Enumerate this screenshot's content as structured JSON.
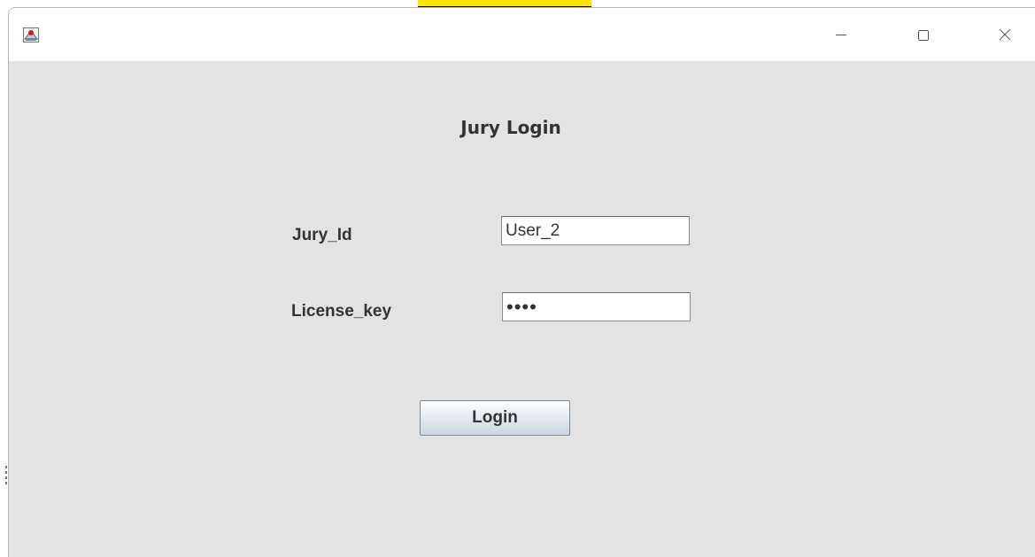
{
  "window": {
    "icon": "java-app-icon",
    "controls": {
      "minimize_icon": "minimize-icon",
      "maximize_icon": "maximize-icon",
      "close_icon": "close-icon"
    }
  },
  "form": {
    "title": "Jury Login",
    "jury_id_label": "Jury_Id",
    "jury_id_value": "User_2",
    "license_key_label": "License_key",
    "license_key_value": "••••",
    "login_label": "Login"
  },
  "colors": {
    "window_background": "#e3e3e3",
    "titlebar_background": "#ffffff",
    "text": "#333333"
  }
}
